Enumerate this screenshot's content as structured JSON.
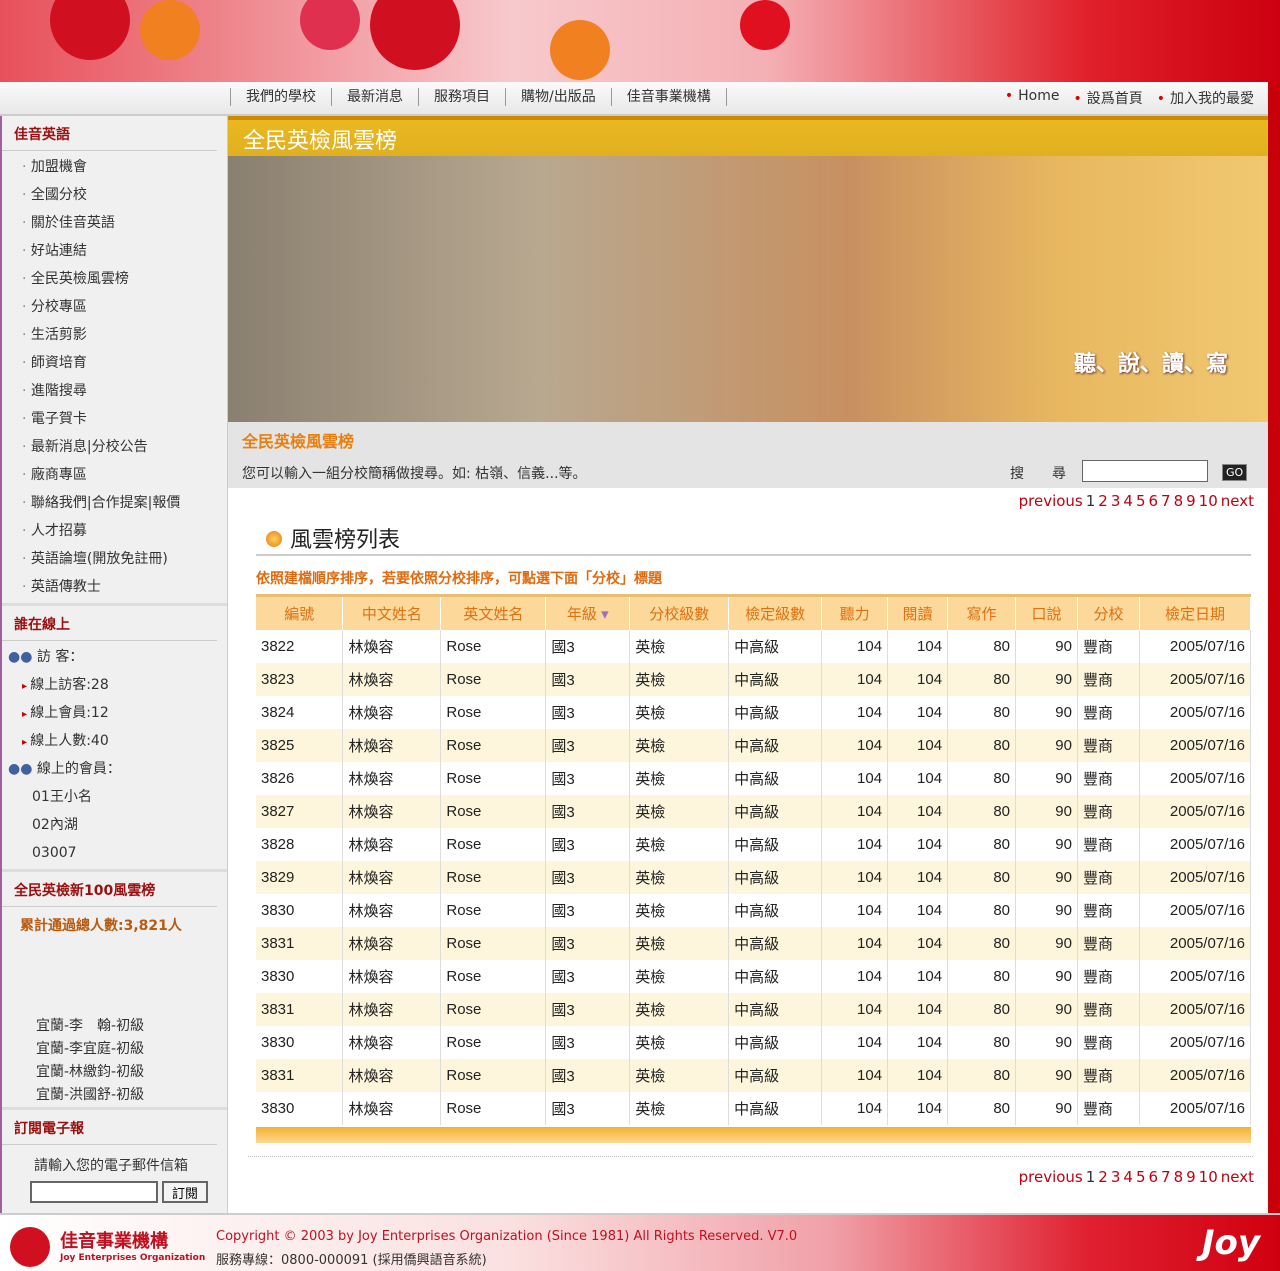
{
  "nav": {
    "links": [
      "我們的學校",
      "最新消息",
      "服務項目",
      "購物/出版品",
      "佳音事業機構"
    ],
    "right": [
      "Home",
      "設爲首頁",
      "加入我的最愛"
    ]
  },
  "sidebar": {
    "title1": "佳音英語",
    "items": [
      "加盟機會",
      "全國分校",
      "關於佳音英語",
      "好站連結",
      "全民英檢風雲榜",
      "分校專區",
      "生活剪影",
      "師資培育",
      "進階搜尋",
      "電子賀卡",
      "最新消息|分校公告",
      "廠商專區",
      "聯絡我們|合作提案|報價",
      "人才招募",
      "英語論壇(開放免註冊)",
      "英語傳教士"
    ],
    "title2": "誰在線上",
    "visitor_label": "訪 客：",
    "visitor_stats": [
      "線上訪客:28",
      "線上會員:12",
      "線上人數:40"
    ],
    "member_label": "線上的會員：",
    "members": [
      "01王小名",
      "02內湖",
      "03007"
    ],
    "title3": "全民英檢新100風雲榜",
    "total": "累計通過總人數:3,821人",
    "scroller": [
      "宜蘭-李　翰-初級",
      "宜蘭-李宜庭-初級",
      "宜蘭-林繳鈞-初級",
      "宜蘭-洪國舒-初級"
    ],
    "title4": "訂閱電子報",
    "email_prompt": "請輸入您的電子郵件信箱",
    "subscribe": "訂閱"
  },
  "main": {
    "title": "全民英檢風雲榜",
    "slogan": "聽、說、讀、寫",
    "search_heading": "全民英檢風雲榜",
    "search_desc": "您可以輸入一組分校簡稱做搜尋。如: 枯嶺、信義...等。",
    "search_label": "搜尋",
    "go": "GO",
    "pager": [
      "previous",
      "1",
      "2",
      "3",
      "4",
      "5",
      "6",
      "7",
      "8",
      "9",
      "10",
      "next"
    ],
    "list_title": "風雲榜列表",
    "note": "依照建檔順序排序，若要依照分校排序，可點選下面「分校」標題",
    "columns": [
      "編號",
      "中文姓名",
      "英文姓名",
      "年級",
      "分校級數",
      "檢定級數",
      "聽力",
      "閱讀",
      "寫作",
      "口說",
      "分校",
      "檢定日期"
    ],
    "rows": [
      [
        "3822",
        "林煥容",
        "Rose",
        "國3",
        "英檢",
        "中高級",
        "104",
        "104",
        "80",
        "90",
        "豐商",
        "2005/07/16"
      ],
      [
        "3823",
        "林煥容",
        "Rose",
        "國3",
        "英檢",
        "中高級",
        "104",
        "104",
        "80",
        "90",
        "豐商",
        "2005/07/16"
      ],
      [
        "3824",
        "林煥容",
        "Rose",
        "國3",
        "英檢",
        "中高級",
        "104",
        "104",
        "80",
        "90",
        "豐商",
        "2005/07/16"
      ],
      [
        "3825",
        "林煥容",
        "Rose",
        "國3",
        "英檢",
        "中高級",
        "104",
        "104",
        "80",
        "90",
        "豐商",
        "2005/07/16"
      ],
      [
        "3826",
        "林煥容",
        "Rose",
        "國3",
        "英檢",
        "中高級",
        "104",
        "104",
        "80",
        "90",
        "豐商",
        "2005/07/16"
      ],
      [
        "3827",
        "林煥容",
        "Rose",
        "國3",
        "英檢",
        "中高級",
        "104",
        "104",
        "80",
        "90",
        "豐商",
        "2005/07/16"
      ],
      [
        "3828",
        "林煥容",
        "Rose",
        "國3",
        "英檢",
        "中高級",
        "104",
        "104",
        "80",
        "90",
        "豐商",
        "2005/07/16"
      ],
      [
        "3829",
        "林煥容",
        "Rose",
        "國3",
        "英檢",
        "中高級",
        "104",
        "104",
        "80",
        "90",
        "豐商",
        "2005/07/16"
      ],
      [
        "3830",
        "林煥容",
        "Rose",
        "國3",
        "英檢",
        "中高級",
        "104",
        "104",
        "80",
        "90",
        "豐商",
        "2005/07/16"
      ],
      [
        "3831",
        "林煥容",
        "Rose",
        "國3",
        "英檢",
        "中高級",
        "104",
        "104",
        "80",
        "90",
        "豐商",
        "2005/07/16"
      ],
      [
        "3830",
        "林煥容",
        "Rose",
        "國3",
        "英檢",
        "中高級",
        "104",
        "104",
        "80",
        "90",
        "豐商",
        "2005/07/16"
      ],
      [
        "3831",
        "林煥容",
        "Rose",
        "國3",
        "英檢",
        "中高級",
        "104",
        "104",
        "80",
        "90",
        "豐商",
        "2005/07/16"
      ],
      [
        "3830",
        "林煥容",
        "Rose",
        "國3",
        "英檢",
        "中高級",
        "104",
        "104",
        "80",
        "90",
        "豐商",
        "2005/07/16"
      ],
      [
        "3831",
        "林煥容",
        "Rose",
        "國3",
        "英檢",
        "中高級",
        "104",
        "104",
        "80",
        "90",
        "豐商",
        "2005/07/16"
      ],
      [
        "3830",
        "林煥容",
        "Rose",
        "國3",
        "英檢",
        "中高級",
        "104",
        "104",
        "80",
        "90",
        "豐商",
        "2005/07/16"
      ]
    ]
  },
  "footer": {
    "logo_cn": "佳音事業機構",
    "logo_en": "Joy Enterprises Organization",
    "copyright": "Copyright © 2003 by Joy Enterprises Organization (Since 1981) All Rights Reserved. V7.0",
    "hotline": "服務專線：0800-000091 (採用僑興語音系統)",
    "brand": "Joy"
  }
}
